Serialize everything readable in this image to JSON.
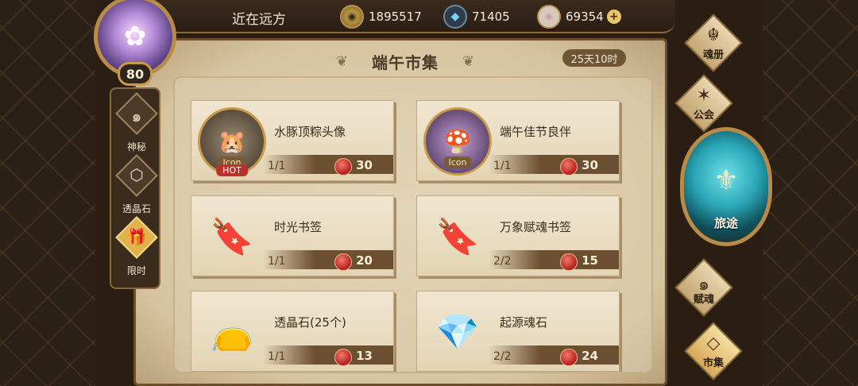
{
  "player": {
    "name": "近在远方",
    "level": "80"
  },
  "resources": {
    "gold": {
      "value": "1895517",
      "icon": "gold-coin-icon"
    },
    "crystal": {
      "value": "71405",
      "icon": "blue-crystal-icon"
    },
    "soulstone": {
      "value": "69354",
      "icon": "soulstone-icon",
      "plus": "+"
    }
  },
  "market": {
    "title": "端午市集",
    "timer": "25天10时",
    "items": [
      {
        "name": "水豚顶粽头像",
        "stock": "1/1",
        "cost": "30",
        "icon_tag": "Icon",
        "hot": "HOT",
        "kind": "avatar"
      },
      {
        "name": "端午佳节良伴",
        "stock": "1/1",
        "cost": "30",
        "icon_tag": "Icon",
        "kind": "avatar"
      },
      {
        "name": "时光书签",
        "stock": "1/1",
        "cost": "20",
        "kind": "bookmark"
      },
      {
        "name": "万象赋魂书签",
        "stock": "2/2",
        "cost": "15",
        "kind": "bookmark"
      },
      {
        "name": "透晶石(25个)",
        "stock": "1/1",
        "cost": "13",
        "kind": "bag"
      },
      {
        "name": "起源魂石",
        "stock": "2/2",
        "cost": "24",
        "kind": "gem"
      }
    ],
    "currency_icon": "red-fruit-icon"
  },
  "left_nav": [
    {
      "label": "神秘",
      "icon": "mystery-swirl-icon"
    },
    {
      "label": "透晶石",
      "icon": "dice-crystal-icon"
    },
    {
      "label": "限时",
      "icon": "gift-box-icon",
      "active": true
    }
  ],
  "right_nav": {
    "soulbook": "魂册",
    "guild": "公会",
    "journey": "旅途",
    "empower": "赋魂",
    "market": "市集"
  },
  "colors": {
    "parchment": "#e9dcc0",
    "frame": "#6b4e2c",
    "accent_gold": "#c99a4c",
    "hot_red": "#b8322a",
    "journey_teal": "#2aa6b6"
  }
}
